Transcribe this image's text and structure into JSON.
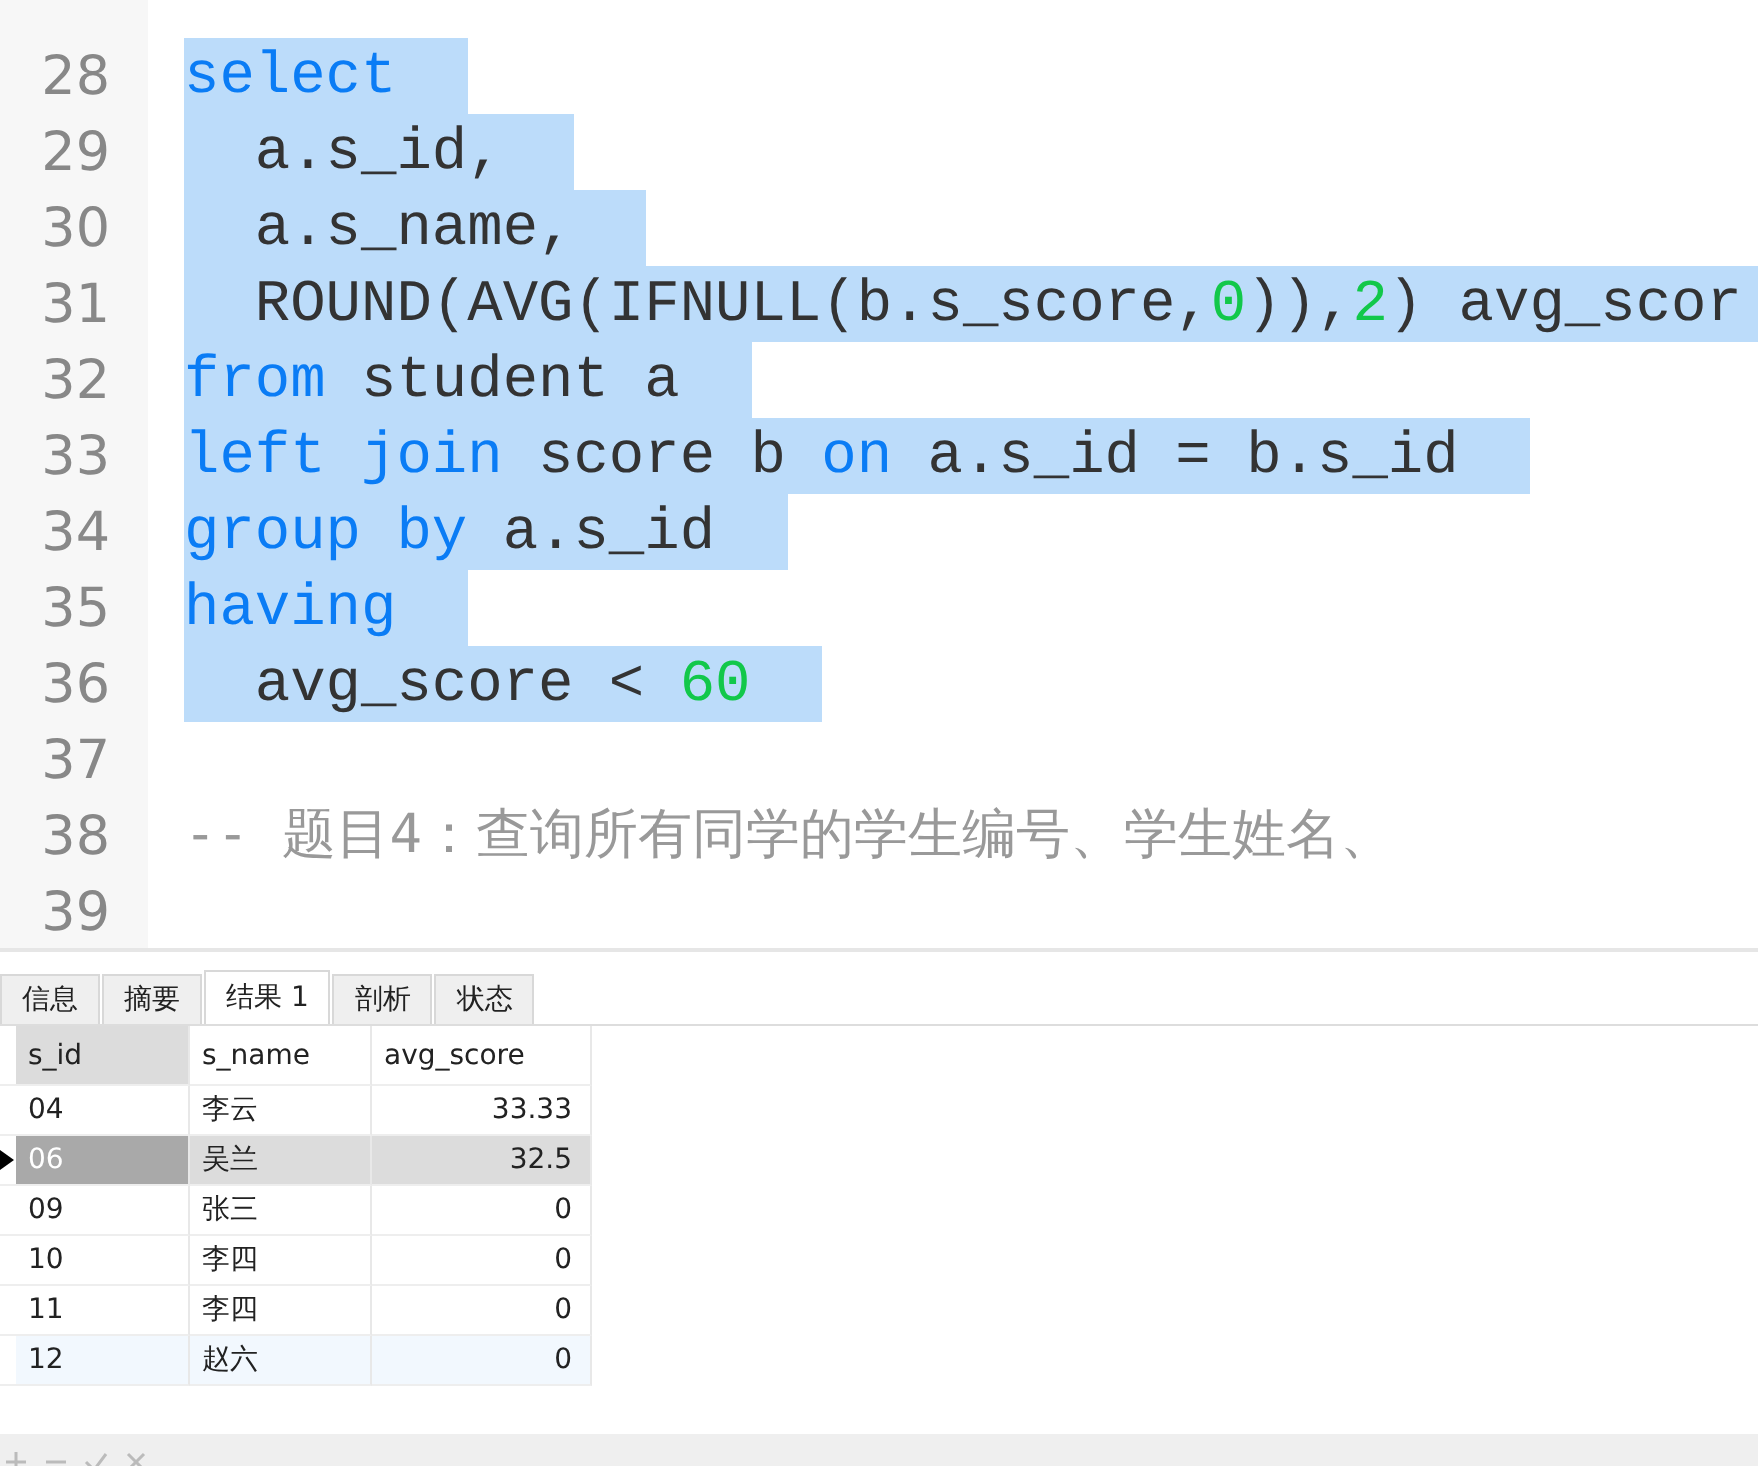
{
  "editor": {
    "lines": [
      {
        "number": "28",
        "selected": true,
        "tokens": [
          {
            "kind": "kw",
            "text": "select"
          }
        ]
      },
      {
        "number": "29",
        "selected": true,
        "tokens": [
          {
            "kind": "text",
            "text": "  a.s_id,"
          }
        ]
      },
      {
        "number": "30",
        "selected": true,
        "tokens": [
          {
            "kind": "text",
            "text": "  a.s_name,"
          }
        ]
      },
      {
        "number": "31",
        "selected": true,
        "tokens": [
          {
            "kind": "text",
            "text": "  ROUND(AVG(IFNULL(b.s_score,"
          },
          {
            "kind": "num",
            "text": "0"
          },
          {
            "kind": "text",
            "text": ")),"
          },
          {
            "kind": "num",
            "text": "2"
          },
          {
            "kind": "text",
            "text": ") avg_scor"
          }
        ]
      },
      {
        "number": "32",
        "selected": true,
        "tokens": [
          {
            "kind": "kw",
            "text": "from"
          },
          {
            "kind": "text",
            "text": " student a"
          }
        ]
      },
      {
        "number": "33",
        "selected": true,
        "tokens": [
          {
            "kind": "kw",
            "text": "left join"
          },
          {
            "kind": "text",
            "text": " score b "
          },
          {
            "kind": "kw",
            "text": "on"
          },
          {
            "kind": "text",
            "text": " a.s_id = b.s_id"
          }
        ]
      },
      {
        "number": "34",
        "selected": true,
        "tokens": [
          {
            "kind": "kw",
            "text": "group by"
          },
          {
            "kind": "text",
            "text": " a.s_id"
          }
        ]
      },
      {
        "number": "35",
        "selected": true,
        "tokens": [
          {
            "kind": "kw",
            "text": "having"
          }
        ]
      },
      {
        "number": "36",
        "selected": true,
        "tokens": [
          {
            "kind": "text",
            "text": "  avg_score < "
          },
          {
            "kind": "num",
            "text": "60"
          }
        ]
      },
      {
        "number": "37"
      },
      {
        "number": "38",
        "selected": false,
        "tokens": [
          {
            "kind": "comment",
            "text": "-- 题目4：查询所有同学的学生编号、学生姓名、"
          }
        ]
      },
      {
        "number": "39"
      }
    ]
  },
  "tabs": [
    {
      "label": "信息",
      "selected": false
    },
    {
      "label": "摘要",
      "selected": false
    },
    {
      "label": "结果 1",
      "selected": true
    },
    {
      "label": "剖析",
      "selected": false
    },
    {
      "label": "状态",
      "selected": false
    }
  ],
  "table": {
    "columns": [
      "s_id",
      "s_name",
      "avg_score"
    ],
    "rows": [
      {
        "cells": [
          "04",
          "李云",
          "33.33"
        ],
        "selected": false,
        "hovered": false
      },
      {
        "cells": [
          "06",
          "吴兰",
          "32.5"
        ],
        "selected": true,
        "hovered": false
      },
      {
        "cells": [
          "09",
          "张三",
          "0"
        ],
        "selected": false,
        "hovered": false
      },
      {
        "cells": [
          "10",
          "李四",
          "0"
        ],
        "selected": false,
        "hovered": false
      },
      {
        "cells": [
          "11",
          "李四",
          "0"
        ],
        "selected": false,
        "hovered": false
      },
      {
        "cells": [
          "12",
          "赵六",
          "0"
        ],
        "selected": false,
        "hovered": true
      }
    ]
  }
}
